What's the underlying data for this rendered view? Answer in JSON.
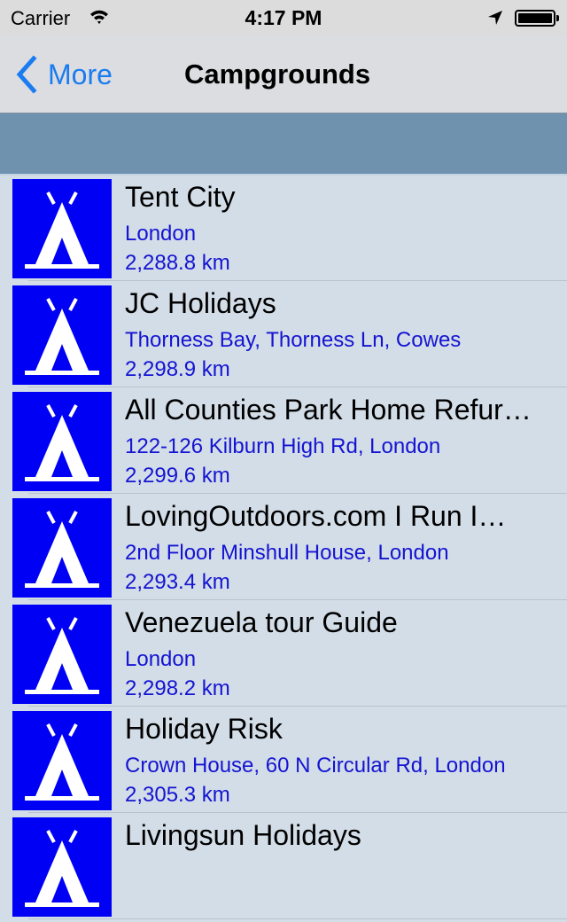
{
  "status_bar": {
    "carrier": "Carrier",
    "time": "4:17 PM",
    "icons": [
      "wifi-icon",
      "location-arrow-icon",
      "battery-icon"
    ]
  },
  "nav": {
    "back_label": "More",
    "back_icon": "chevron-left-icon",
    "title": "Campgrounds"
  },
  "colors": {
    "accent": "#1a7cf0",
    "icon_bg": "#0000f5",
    "subtitle": "#1414d2",
    "band": "#6f93ae",
    "list_bg": "#d3dde7"
  },
  "campgrounds": [
    {
      "name": "Tent City",
      "address": "London",
      "distance": "2,288.8 km",
      "icon": "tent-icon"
    },
    {
      "name": "JC Holidays",
      "address": "Thorness Bay, Thorness Ln, Cowes",
      "distance": "2,298.9 km",
      "icon": "tent-icon"
    },
    {
      "name": "All Counties Park Home Refur…",
      "address": "122-126 Kilburn High Rd, London",
      "distance": "2,299.6 km",
      "icon": "tent-icon"
    },
    {
      "name": "LovingOutdoors.com I Run I…",
      "address": "2nd Floor Minshull House, London",
      "distance": "2,293.4 km",
      "icon": "tent-icon"
    },
    {
      "name": "Venezuela tour Guide",
      "address": "London",
      "distance": "2,298.2 km",
      "icon": "tent-icon"
    },
    {
      "name": "Holiday Risk",
      "address": "Crown House, 60 N Circular Rd, London",
      "distance": "2,305.3 km",
      "icon": "tent-icon"
    },
    {
      "name": "Livingsun Holidays",
      "address": "",
      "distance": "",
      "icon": "tent-icon"
    }
  ]
}
